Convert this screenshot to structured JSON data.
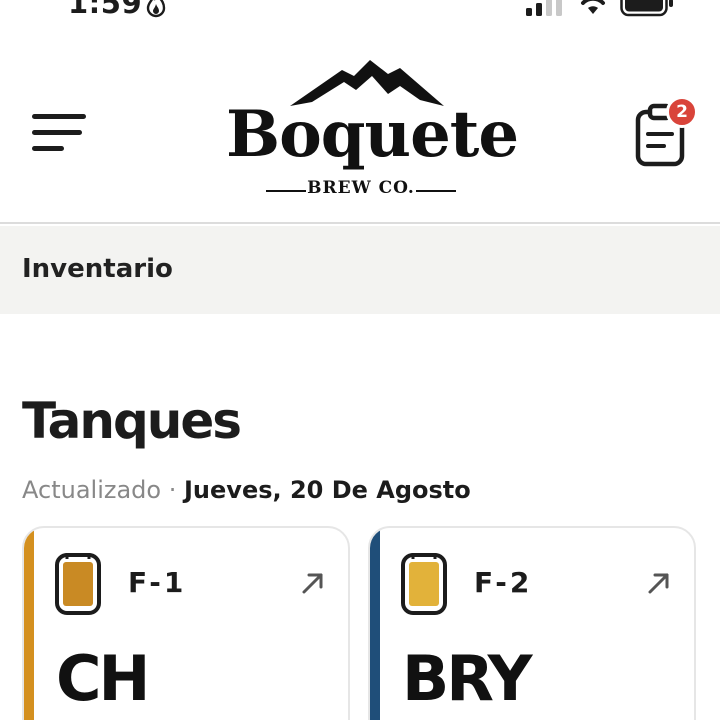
{
  "status_bar": {
    "time": "1:59",
    "icons": [
      "flame-icon",
      "signal-icon",
      "wifi-icon",
      "battery-icon"
    ]
  },
  "header": {
    "menu_icon": "hamburger-menu-icon",
    "logo": {
      "name": "Boquete",
      "subtitle": "BREW CO."
    },
    "clipboard_icon": "clipboard-icon",
    "badge_count": "2"
  },
  "section": {
    "title": "Inventario"
  },
  "main": {
    "title": "Tanques",
    "updated_label": "Actualizado",
    "separator": "·",
    "updated_date": "Jueves, 20 De Agosto"
  },
  "tanks": [
    {
      "id": "F-1",
      "beer": "CH",
      "accent_color": "#d4901f",
      "fill_color": "#c98a24",
      "arrow_icon": "arrow-up-right-icon"
    },
    {
      "id": "F-2",
      "beer": "BRY",
      "accent_color": "#1f4e79",
      "fill_color": "#e2b23a",
      "arrow_icon": "arrow-up-right-icon"
    }
  ],
  "colors": {
    "badge": "#d9443a",
    "section_bg": "#f3f3f1",
    "muted_text": "#888888"
  }
}
